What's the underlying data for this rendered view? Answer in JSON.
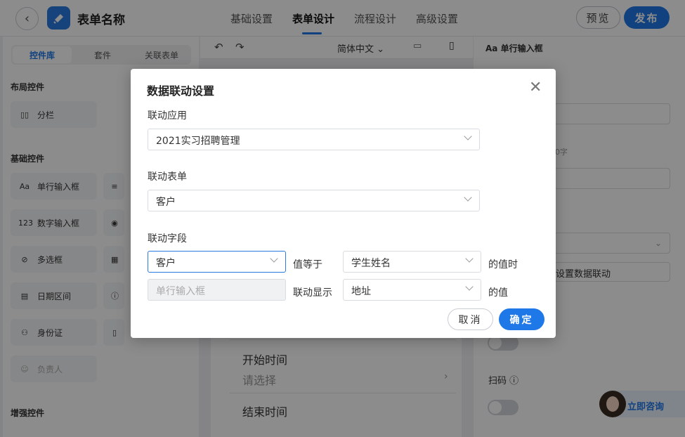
{
  "header": {
    "app_title": "表单名称",
    "tabs": [
      {
        "label": "基础设置"
      },
      {
        "label": "表单设计"
      },
      {
        "label": "流程设计"
      },
      {
        "label": "高级设置"
      }
    ],
    "preview_label": "预览",
    "publish_label": "发布"
  },
  "left_panel": {
    "tabs": [
      {
        "label": "控件库"
      },
      {
        "label": "套件"
      },
      {
        "label": "关联表单"
      }
    ],
    "layout_section": "布局控件",
    "layout_items": [
      {
        "label": "分栏",
        "icon": "columns-icon"
      }
    ],
    "basic_section": "基础控件",
    "basic_items": [
      {
        "label": "单行输入框",
        "icon": "text-input-icon",
        "glyph": "Aa"
      },
      {
        "label": "数字输入框",
        "icon": "number-input-icon",
        "glyph": "123"
      },
      {
        "label": "多选框",
        "icon": "checkbox-icon"
      },
      {
        "label": "日期区间",
        "icon": "date-range-icon"
      },
      {
        "label": "身份证",
        "icon": "id-card-icon"
      },
      {
        "label": "负责人",
        "icon": "person-icon"
      }
    ],
    "enhanced_section": "增强控件"
  },
  "canvas": {
    "language": "简体中文",
    "fields": [
      {
        "label": "开始时间",
        "placeholder": "请选择"
      },
      {
        "label": "结束时间"
      }
    ]
  },
  "right_panel": {
    "header": "单行输入框",
    "header_glyph": "Aa",
    "char_hint": "0字",
    "link_button": "设置数据联动",
    "scan_label": "扫码"
  },
  "consult": {
    "label": "立即咨询"
  },
  "modal": {
    "title": "数据联动设置",
    "app_label": "联动应用",
    "app_value": "2021实习招聘管理",
    "form_label": "联动表单",
    "form_value": "客户",
    "field_label": "联动字段",
    "condition": {
      "left_value": "客户",
      "operator": "值等于",
      "right_value": "学生姓名",
      "suffix": "的值时"
    },
    "display": {
      "left_value": "单行输入框",
      "operator": "联动显示",
      "right_value": "地址",
      "suffix": "的值"
    },
    "cancel_label": "取消",
    "ok_label": "确定"
  },
  "colors": {
    "accent": "#1f78e8",
    "overlay": "rgba(0,0,0,0.45)"
  }
}
